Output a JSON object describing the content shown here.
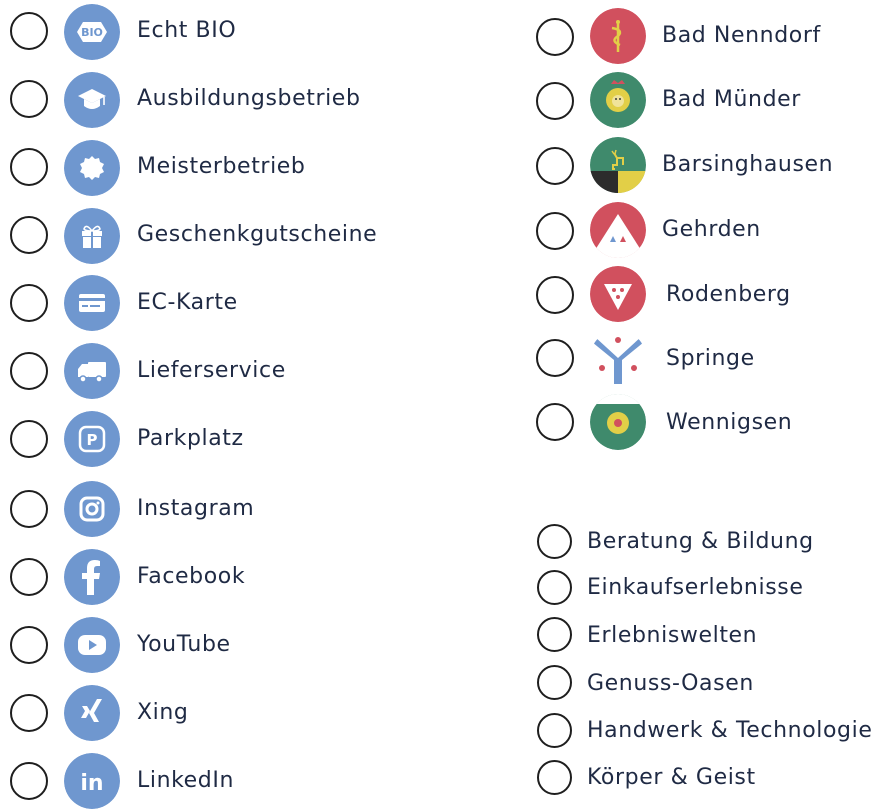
{
  "features": [
    {
      "label": "Echt BIO",
      "icon": "bio-icon"
    },
    {
      "label": "Ausbildungsbetrieb",
      "icon": "graduation-cap-icon"
    },
    {
      "label": "Meisterbetrieb",
      "icon": "seal-badge-icon"
    },
    {
      "label": "Geschenkgutscheine",
      "icon": "gift-icon"
    },
    {
      "label": "EC-Karte",
      "icon": "credit-card-icon"
    },
    {
      "label": "Lieferservice",
      "icon": "truck-icon"
    },
    {
      "label": "Parkplatz",
      "icon": "parking-icon"
    },
    {
      "label": "Instagram",
      "icon": "instagram-icon"
    },
    {
      "label": "Facebook",
      "icon": "facebook-icon"
    },
    {
      "label": "YouTube",
      "icon": "youtube-icon"
    },
    {
      "label": "Xing",
      "icon": "xing-icon"
    },
    {
      "label": "LinkedIn",
      "icon": "linkedin-icon"
    }
  ],
  "feature_icon_text": {
    "bio": "BIO",
    "parking": "P",
    "linkedin": "in"
  },
  "towns": [
    {
      "label": "Bad Nenndorf",
      "icon": "bad-nenndorf-crest-icon"
    },
    {
      "label": "Bad Münder",
      "icon": "bad-muender-crest-icon"
    },
    {
      "label": "Barsinghausen",
      "icon": "barsinghausen-crest-icon"
    },
    {
      "label": "Gehrden",
      "icon": "gehrden-crest-icon"
    },
    {
      "label": "Rodenberg",
      "icon": "rodenberg-crest-icon"
    },
    {
      "label": "Springe",
      "icon": "springe-crest-icon"
    },
    {
      "label": "Wennigsen",
      "icon": "wennigsen-crest-icon"
    }
  ],
  "categories": [
    {
      "label": "Beratung & Bildung"
    },
    {
      "label": "Einkaufserlebnisse"
    },
    {
      "label": "Erlebniswelten"
    },
    {
      "label": "Genuss-Oasen"
    },
    {
      "label": "Handwerk & Technologie"
    },
    {
      "label": "Körper & Geist"
    }
  ],
  "colors": {
    "icon_blue": "#6f97cf",
    "crest_red": "#d1505e",
    "crest_green": "#3f8a6c",
    "crest_yellow": "#e2cf47",
    "text": "#1f2a44",
    "radio_border": "#1e1e1e"
  }
}
